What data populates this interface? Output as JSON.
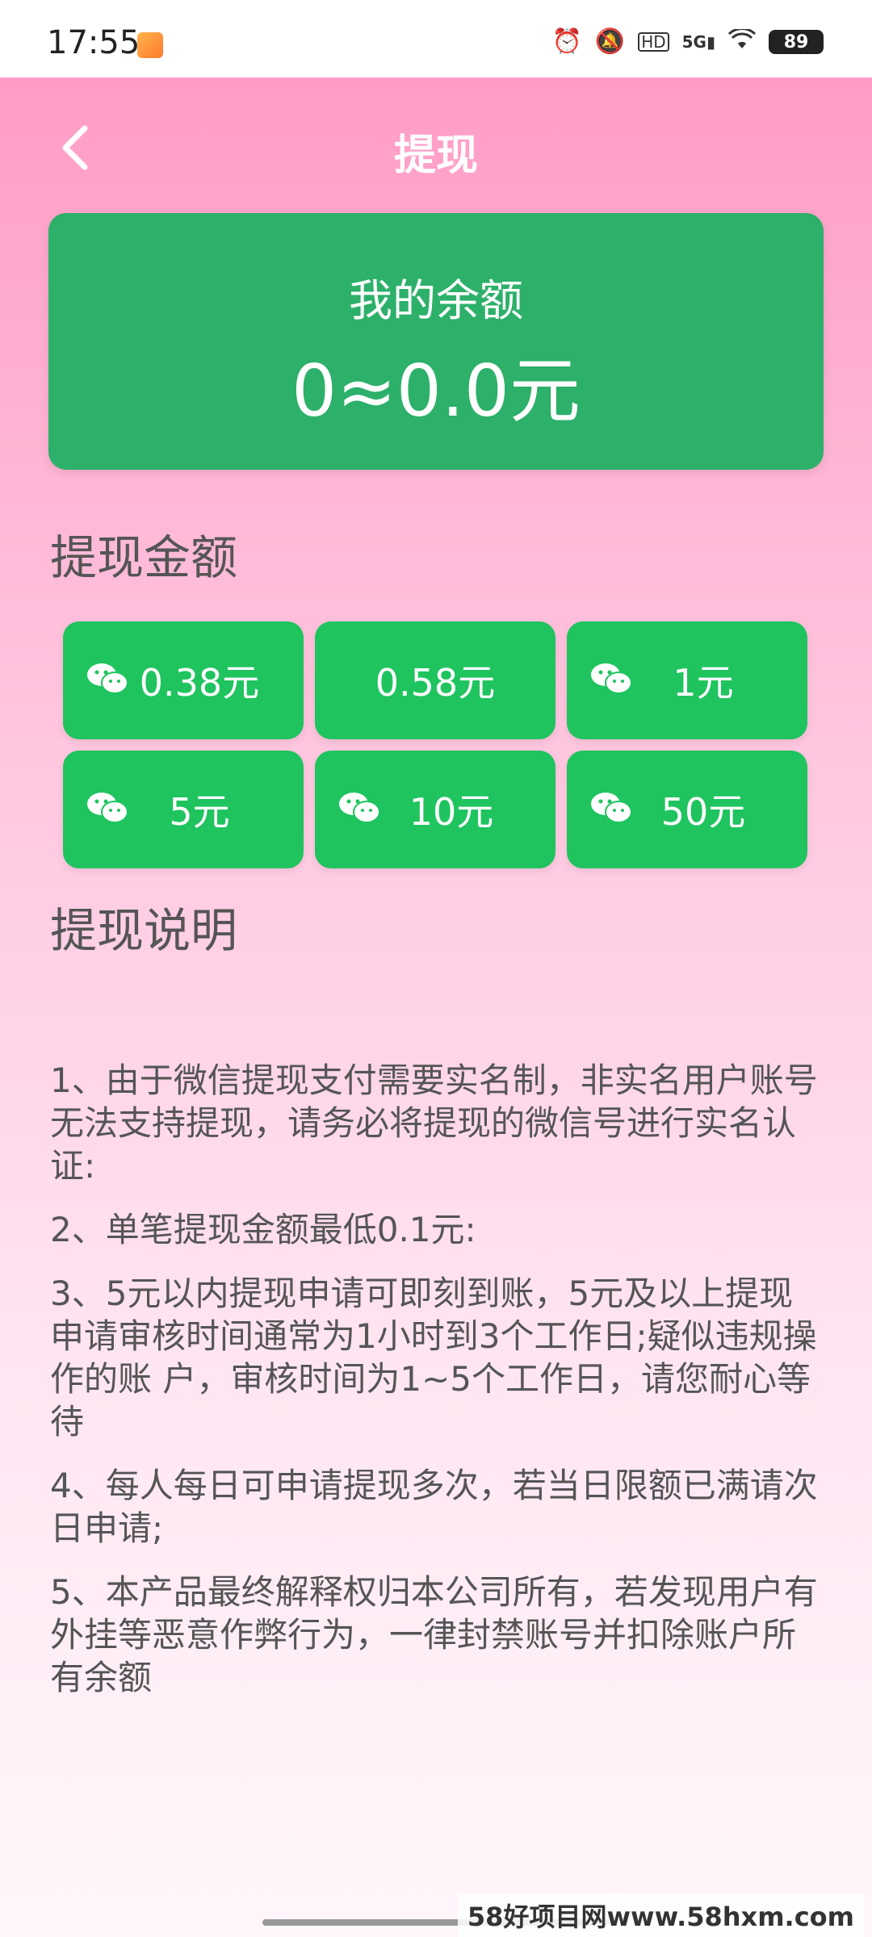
{
  "status_bar": {
    "time": "17:55",
    "icons": [
      "alarm-icon",
      "mute-icon",
      "hd-icon",
      "5g-signal-icon",
      "wifi-icon"
    ],
    "network": "5G",
    "battery": "89"
  },
  "header": {
    "title": "提现"
  },
  "balance": {
    "label": "我的余额",
    "value": "0≈0.0元"
  },
  "withdraw": {
    "section_title": "提现金额",
    "options": [
      {
        "label": "0.38元",
        "icon": "wechat-icon"
      },
      {
        "label": "0.58元",
        "icon": ""
      },
      {
        "label": "1元",
        "icon": "wechat-icon"
      },
      {
        "label": "5元",
        "icon": "wechat-icon"
      },
      {
        "label": "10元",
        "icon": "wechat-icon"
      },
      {
        "label": "50元",
        "icon": "wechat-icon"
      }
    ]
  },
  "notes": {
    "section_title": "提现说明",
    "items": [
      "1、由于微信提现支付需要实名制，非实名用户账号无法支持提现，请务必将提现的微信号进行实名认证:",
      "2、单笔提现金额最低0.1元:",
      "3、5元以内提现申请可即刻到账，5元及以上提现申请审核时间通常为1小时到3个工作日;疑似违规操作的账 户，审核时间为1~5个工作日，请您耐心等待",
      "4、每人每日可申请提现多次，若当日限额已满请次日申请;",
      "5、本产品最终解释权归本公司所有，若发现用户有外挂等恶意作弊行为，一律封禁账号并扣除账户所有余额"
    ]
  },
  "watermark": "58好项目网www.58hxm.com",
  "colors": {
    "card_green": "#2db06a",
    "button_green": "#1fc45f",
    "pink_top": "#ff9cc6",
    "text_gray": "#555555"
  }
}
